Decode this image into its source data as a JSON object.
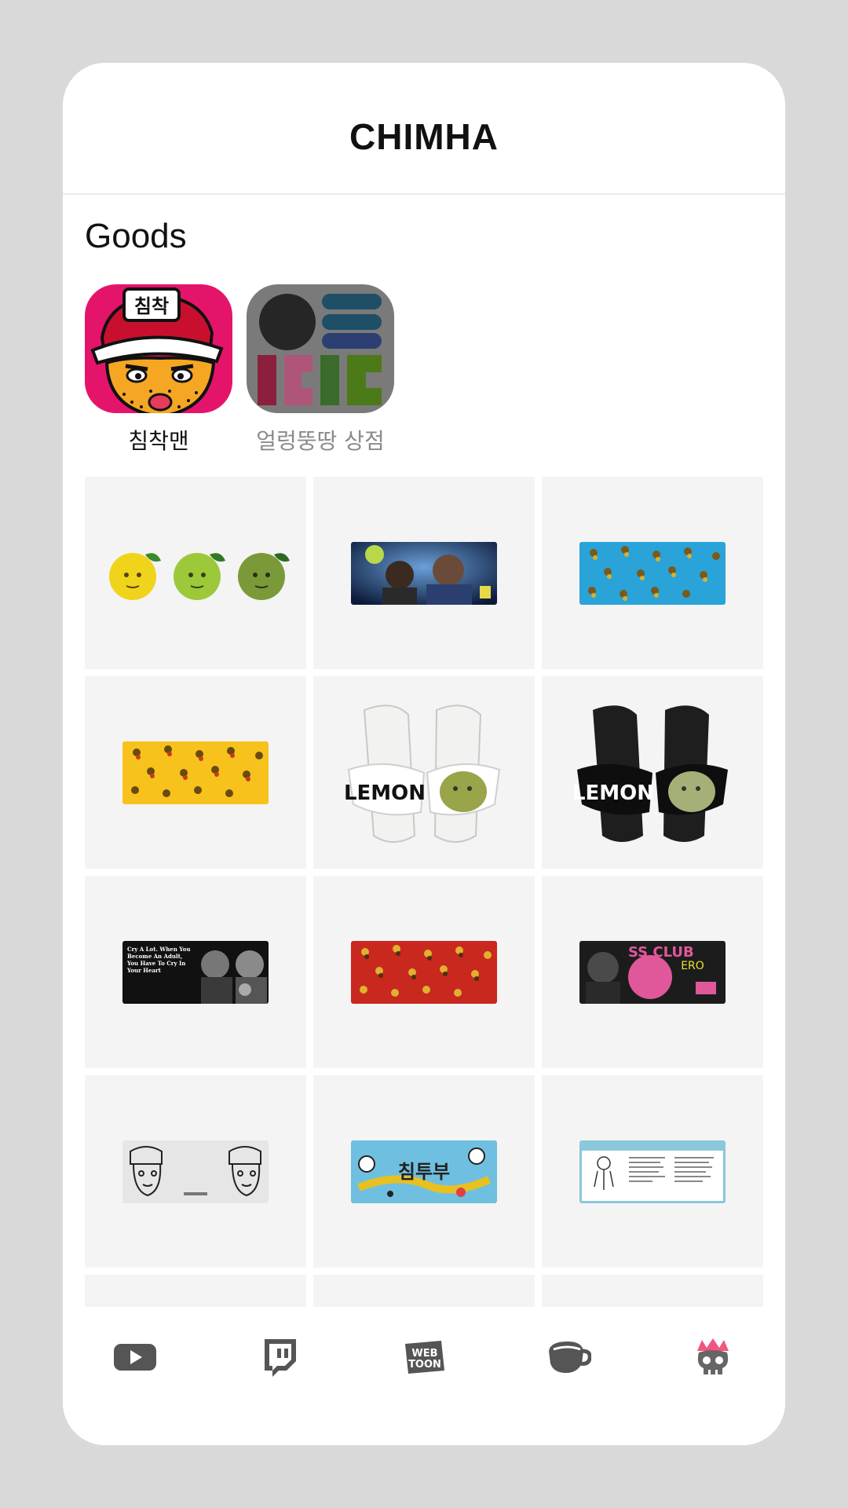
{
  "header": {
    "title": "CHIMHA"
  },
  "section": {
    "title": "Goods"
  },
  "shops": [
    {
      "label": "침착맨",
      "active": true,
      "logo_text": "침착"
    },
    {
      "label": "얼렁뚱땅 상점",
      "active": false
    }
  ],
  "products": [
    {
      "name": "lemon-faces"
    },
    {
      "name": "space-duo-mousepad"
    },
    {
      "name": "blue-pattern-mousepad"
    },
    {
      "name": "yellow-pattern-mousepad"
    },
    {
      "name": "white-lemon-slides",
      "print": "LEMON"
    },
    {
      "name": "black-lemon-slides",
      "print": "LEMON"
    },
    {
      "name": "cry-a-lot-mousepad",
      "print": "Cry A Lot. When You Become An Adult, You Have To Cry In Your Heart"
    },
    {
      "name": "red-pattern-mousepad"
    },
    {
      "name": "ss-club-mousepad",
      "print": "SS CLUB"
    },
    {
      "name": "sketch-mousepad"
    },
    {
      "name": "chimtubu-mousepad",
      "print": "침투부"
    },
    {
      "name": "info-mousepad"
    }
  ],
  "tabbar": {
    "items": [
      {
        "icon": "youtube-icon"
      },
      {
        "icon": "twitch-icon"
      },
      {
        "icon": "webtoon-icon",
        "text": "WEB TOON"
      },
      {
        "icon": "coffee-cup-icon"
      },
      {
        "icon": "skull-crown-icon",
        "active": true
      }
    ]
  },
  "colors": {
    "shop1_bg": "#e5146b",
    "shop2_bg": "#7a7a7a",
    "active_tab": "#f2557f",
    "tab_icon": "#555555"
  }
}
